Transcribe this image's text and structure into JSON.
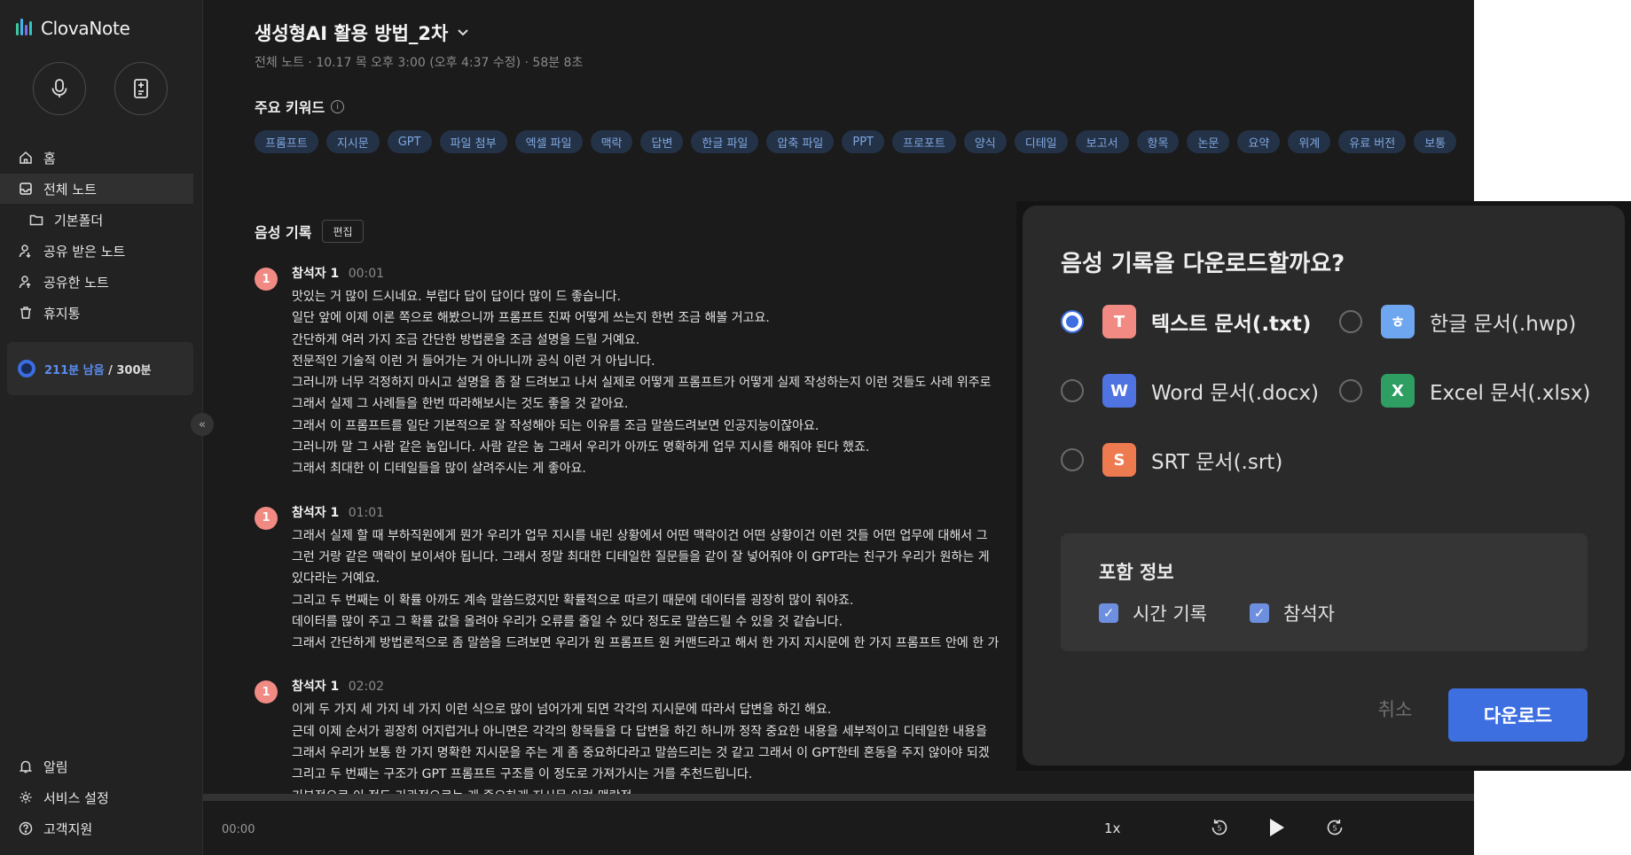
{
  "app": {
    "logo_text": "ClovaNote",
    "brand_color": "#3d6fe0"
  },
  "sidebar": {
    "nav": [
      {
        "label": "홈",
        "icon": "home-icon"
      },
      {
        "label": "전체 노트",
        "icon": "notes-icon",
        "active": true
      },
      {
        "label": "기본폴더",
        "icon": "folder-icon"
      },
      {
        "label": "공유 받은 노트",
        "icon": "shared-in-icon"
      },
      {
        "label": "공유한 노트",
        "icon": "shared-out-icon"
      },
      {
        "label": "휴지통",
        "icon": "trash-icon"
      }
    ],
    "quota": {
      "remaining": "211분 남음",
      "total": " / 300분"
    },
    "collapse_icon": "«",
    "bottom": [
      {
        "label": "알림",
        "icon": "bell-icon"
      },
      {
        "label": "서비스 설정",
        "icon": "gear-icon"
      },
      {
        "label": "고객지원",
        "icon": "help-icon"
      }
    ]
  },
  "note": {
    "title": "생성형AI 활용 방법_2차",
    "meta": "전체 노트 · 10.17 목 오후 3:00 (오후 4:37 수정) · 58분 8초",
    "keywords_heading": "주요 키워드",
    "keywords": [
      "프롬프트",
      "지시문",
      "GPT",
      "파일 첨부",
      "엑셀 파일",
      "맥락",
      "답변",
      "한글 파일",
      "압축 파일",
      "PPT",
      "프로포트",
      "양식",
      "디테일",
      "보고서",
      "항목",
      "논문",
      "요약",
      "위계",
      "유료 버전",
      "보통"
    ],
    "recording_heading": "음성 기록",
    "edit_label": "편집",
    "segments": [
      {
        "badge": "1",
        "speaker": "참석자 1",
        "time": "00:01",
        "lines": [
          "맛있는 거 많이 드시네요. 부럽다 답이 답이다 많이 드 좋습니다.",
          "일단 앞에 이제 이론 쪽으로 해봤으니까 프롬프트 진짜 어떻게 쓰는지 한번 조금 해볼 거고요.",
          "간단하게 여러 가지 조금 간단한 방법론을 조금 설명을 드릴 거예요.",
          "전문적인 기술적 이런 거 들어가는 거 아니니까 공식 이런 거 아닙니다.",
          "그러니까 너무 걱정하지 마시고 설명을 좀 잘 드려보고 나서 실제로 어떻게 프롬프트가 어떻게 실제 작성하는지 이런 것들도 사례 위주로",
          "그래서 실제 그 사례들을 한번 따라해보시는 것도 좋을 것 같아요.",
          "그래서 이 프롬프트를 일단 기본적으로 잘 작성해야 되는 이유를 조금 말씀드려보면 인공지능이잖아요.",
          "그러니까 말 그 사람 같은 놈입니다. 사람 같은 놈 그래서 우리가 아까도 명확하게 업무 지시를 해줘야 된다 했죠.",
          "그래서 최대한 이 디테일들을 많이 살려주시는 게 좋아요."
        ]
      },
      {
        "badge": "1",
        "speaker": "참석자 1",
        "time": "01:01",
        "lines": [
          "그래서 실제 할 때 부하직원에게 뭔가 우리가 업무 지시를 내린 상황에서 어떤 맥락이건 어떤 상황이건 이런 것들 어떤 업무에 대해서 그",
          "그런 거랑 같은 맥락이 보이셔야 됩니다. 그래서 정말 최대한 디테일한 질문들을 같이 잘 넣어줘야 이 GPT라는 친구가 우리가 원하는 게",
          "있다라는 거예요.",
          "그리고 두 번째는 이 확률 아까도 계속 말씀드렸지만 확률적으로 따르기 때문에 데이터를 굉장히 많이 줘야죠.",
          "데이터를 많이 주고 그 확률 값을 올려야 우리가 오류를 줄일 수 있다 정도로 말씀드릴 수 있을 것 같습니다.",
          "그래서 간단하게 방법론적으로 좀 말씀을 드려보면 우리가 원 프롬프트 원 커맨드라고 해서 한 가지 지시문에 한 가지 프롬프트 안에 한 가"
        ]
      },
      {
        "badge": "1",
        "speaker": "참석자 1",
        "time": "02:02",
        "lines": [
          "이게 두 가지 세 가지 네 가지 이런 식으로 많이 넘어가게 되면 각각의 지시문에 따라서 답변을 하긴 해요.",
          "근데 이제 순서가 굉장히 어지럽거나 아니면은 각각의 항목들을 다 답변을 하긴 하니까 정작 중요한 내용을 세부적이고 디테일한 내용을",
          "그래서 우리가 보통 한 가지 명확한 지시문을 주는 게 좀 중요하다라고 말씀드리는 것 같고 그래서 이 GPT한테 혼동을 주지 않아야 되겠",
          "그리고 두 번째는 구조가 GPT 프롬프트 구조를 이 정도로 가져가시는 거를 추천드립니다.",
          "기본적으로 이 정도 기관적으로는 게 중요하게 지시문 이런 맥락적"
        ]
      }
    ]
  },
  "player": {
    "current_time": "00:00",
    "speed": "1x",
    "back_label": "5",
    "forward_label": "5",
    "progress": 0
  },
  "dialog": {
    "title": "음성 기록을 다운로드할까요?",
    "options": [
      {
        "label": "텍스트 문서(.txt)",
        "letter": "T",
        "color": "#f08a82",
        "selected": true
      },
      {
        "label": "한글 문서(.hwp)",
        "letter": "ㅎ",
        "color": "#6ea6f0",
        "selected": false
      },
      {
        "label": "Word 문서(.docx)",
        "letter": "W",
        "color": "#4f73e0",
        "selected": false
      },
      {
        "label": "Excel 문서(.xlsx)",
        "letter": "X",
        "color": "#2e9e62",
        "selected": false
      },
      {
        "label": "SRT 문서(.srt)",
        "letter": "S",
        "color": "#ee7a50",
        "selected": false
      }
    ],
    "include_title": "포함 정보",
    "include": [
      {
        "label": "시간 기록",
        "checked": true
      },
      {
        "label": "참석자",
        "checked": true
      }
    ],
    "cancel_label": "취소",
    "download_label": "다운로드"
  }
}
